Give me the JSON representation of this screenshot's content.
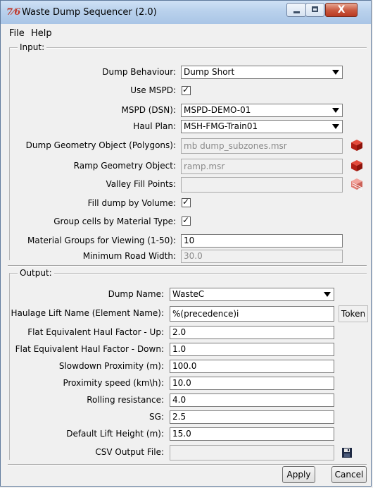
{
  "window": {
    "title": "Waste Dump Sequencer (2.0)",
    "app_icon_text": "7⁄6",
    "close_glyph": "X"
  },
  "menu": {
    "file": "File",
    "help": "Help"
  },
  "input_group": {
    "label": "Input:",
    "dump_behaviour": {
      "label": "Dump Behaviour:",
      "value": "Dump Short"
    },
    "use_mspd": {
      "label": "Use MSPD:",
      "checked": true
    },
    "mspd_dsn": {
      "label": "MSPD (DSN):",
      "value": "MSPD-DEMO-01"
    },
    "haul_plan": {
      "label": "Haul Plan:",
      "value": "MSH-FMG-Train01"
    },
    "dump_geometry": {
      "label": "Dump Geometry Object (Polygons):",
      "value": "mb dump_subzones.msr"
    },
    "ramp_geometry": {
      "label": "Ramp Geometry Object:",
      "value": "ramp.msr"
    },
    "valley_fill": {
      "label": "Valley Fill Points:",
      "value": ""
    },
    "fill_by_volume": {
      "label": "Fill dump by Volume:",
      "checked": true
    },
    "group_cells": {
      "label": "Group cells by Material Type:",
      "checked": true
    },
    "material_groups": {
      "label": "Material Groups for Viewing (1-50):",
      "value": "10"
    },
    "min_road_width": {
      "label": "Minimum Road Width:",
      "value": "30.0"
    }
  },
  "output_group": {
    "label": "Output:",
    "dump_name": {
      "label": "Dump Name:",
      "value": "WasteC"
    },
    "haulage_lift_name": {
      "label": "Haulage Lift Name (Element Name):",
      "value": "%(precedence)i",
      "token_label": "Token"
    },
    "haul_factor_up": {
      "label": "Flat Equivalent Haul Factor - Up:",
      "value": "2.0"
    },
    "haul_factor_down": {
      "label": "Flat Equivalent Haul Factor - Down:",
      "value": "1.0"
    },
    "slowdown_proximity": {
      "label": "Slowdown Proximity (m):",
      "value": "100.0"
    },
    "proximity_speed": {
      "label": "Proximity speed (km\\h):",
      "value": "10.0"
    },
    "rolling_resistance": {
      "label": "Rolling resistance:",
      "value": "4.0"
    },
    "sg": {
      "label": "SG:",
      "value": "2.5"
    },
    "default_lift_height": {
      "label": "Default Lift Height (m):",
      "value": "15.0"
    },
    "csv_output_file": {
      "label": "CSV Output File:",
      "value": ""
    }
  },
  "buttons": {
    "apply": "Apply",
    "cancel": "Cancel"
  },
  "icons": {
    "cube_picker": "red-cube-icon",
    "cube_picker_disabled": "red-cube-disabled-icon",
    "save": "floppy-disk-icon"
  }
}
